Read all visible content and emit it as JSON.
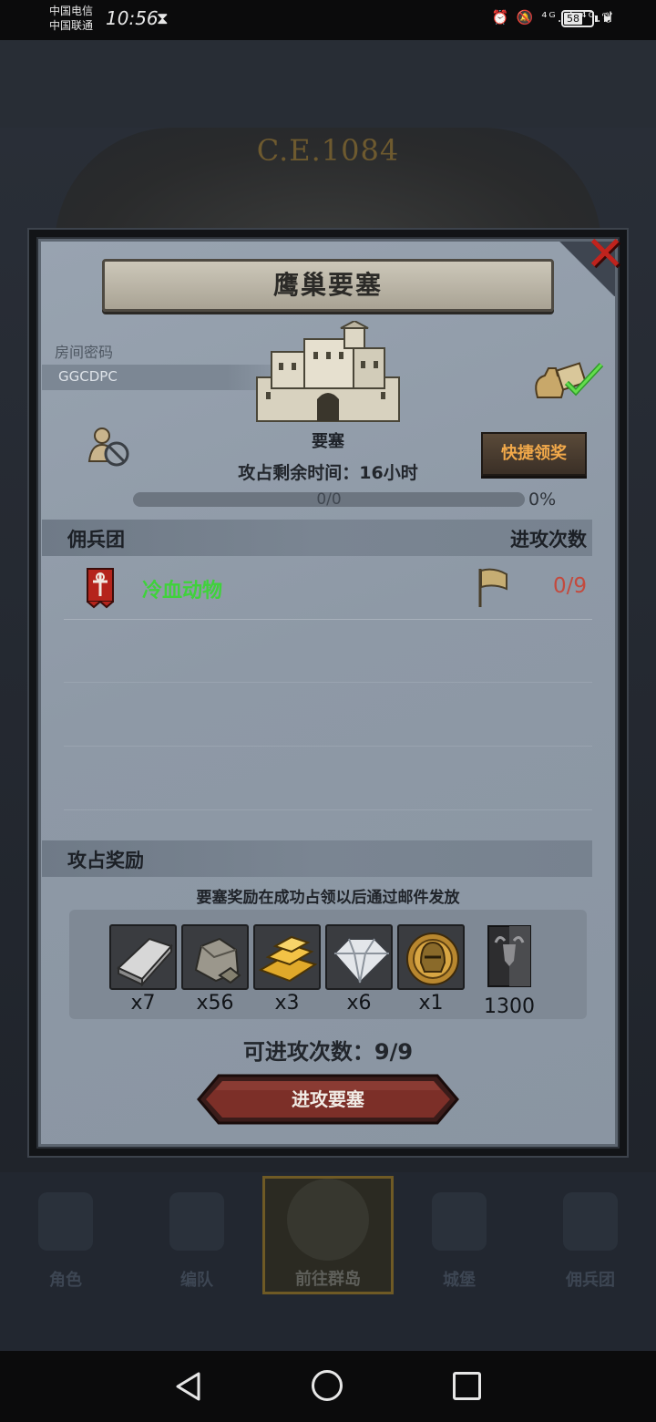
{
  "status_bar": {
    "carrier_1": "中国电信",
    "carrier_2": "中国联通",
    "time": "10:56",
    "status_icons": "⏰ 🔕 ⁴ᴳ.ıl ⁴ᴳ.ıl",
    "battery": "58"
  },
  "background": {
    "era_text": "C.E.1084"
  },
  "dialog": {
    "title": "鹰巢要塞",
    "room_label": "房间密码",
    "room_code": "GGCDPC",
    "building_label": "要塞",
    "quick_claim_label": "快捷领奖",
    "remaining_time": "攻占剩余时间：16小时",
    "progress_text": "0/0",
    "progress_percent": "0%",
    "progress_fraction": 0,
    "mercenary_section": {
      "title": "佣兵团",
      "column": "进攻次数"
    },
    "mercenaries": [
      {
        "name": "冷血动物",
        "attacks": "0/9"
      }
    ],
    "rewards_section": {
      "title": "攻占奖励",
      "note": "要塞奖励在成功占领以后通过邮件发放"
    },
    "rewards": [
      {
        "icon": "iron-ingot-icon",
        "qty": "x7"
      },
      {
        "icon": "stone-ore-icon",
        "qty": "x56"
      },
      {
        "icon": "gold-bars-icon",
        "qty": "x3"
      },
      {
        "icon": "diamond-icon",
        "qty": "x6"
      },
      {
        "icon": "golden-helmet-icon",
        "qty": "x1"
      },
      {
        "icon": "horned-banner-icon",
        "qty": "1300"
      }
    ],
    "attempts_text": "可进攻次数：9/9",
    "attack_button_label": "进攻要塞"
  },
  "game_nav": [
    {
      "label": "角色",
      "icon": "knight-icon"
    },
    {
      "label": "编队",
      "icon": "formation-icon"
    },
    {
      "label": "前往群岛",
      "icon": "compass-map-icon",
      "active": true
    },
    {
      "label": "城堡",
      "icon": "castle-icon"
    },
    {
      "label": "佣兵团",
      "icon": "mercenary-icon"
    }
  ],
  "colors": {
    "close_red": "#c0231d",
    "merc_name_green": "#3fd23b",
    "attack_count_red": "#c34a3e",
    "quick_claim_text": "#f2a94a"
  }
}
